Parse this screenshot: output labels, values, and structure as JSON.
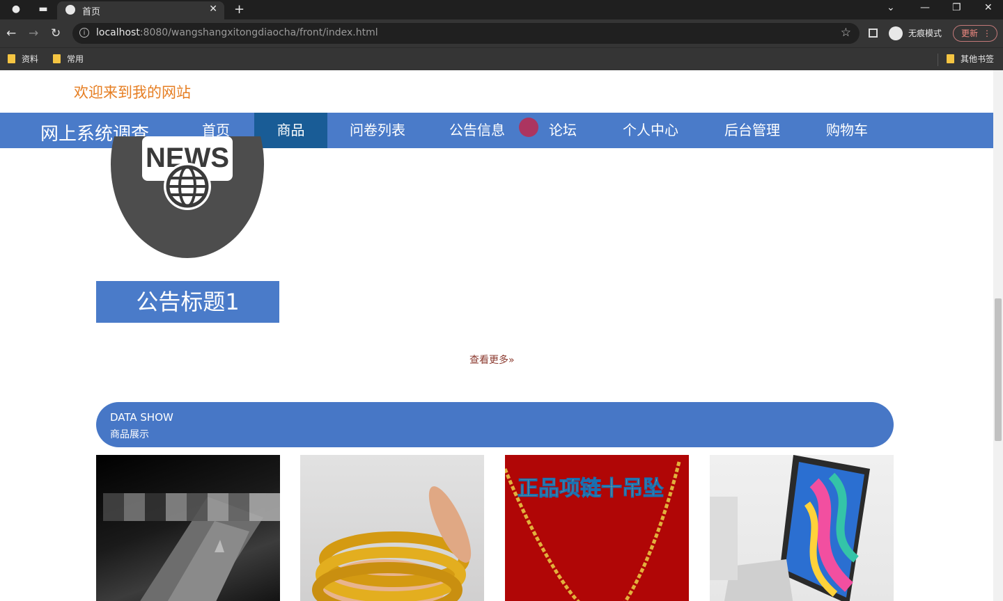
{
  "browser": {
    "tab_title": "首页",
    "url_host": "localhost",
    "url_rest": ":8080/wangshangxitongdiaocha/front/index.html",
    "incognito_label": "无痕模式",
    "update_label": "更新",
    "bookmarks": [
      "资料",
      "常用"
    ],
    "other_bookmarks": "其他书签"
  },
  "site": {
    "welcome": "欢迎来到我的网站",
    "brand": "网上系统调查",
    "nav": [
      "首页",
      "商品",
      "问卷列表",
      "公告信息",
      "论坛",
      "个人中心",
      "后台管理",
      "购物车"
    ],
    "active_nav": "商品"
  },
  "notice": {
    "image_text": "NEWS",
    "title": "公告标题1",
    "more": "查看更多"
  },
  "products_section": {
    "en": "DATA SHOW",
    "cn": "商品展示",
    "product3_text": "正品项链十吊坠"
  },
  "colors": {
    "nav_bg": "#4a7bc9",
    "nav_active": "#195c96",
    "welcome": "#e67e22",
    "more": "#8b3a2f"
  }
}
